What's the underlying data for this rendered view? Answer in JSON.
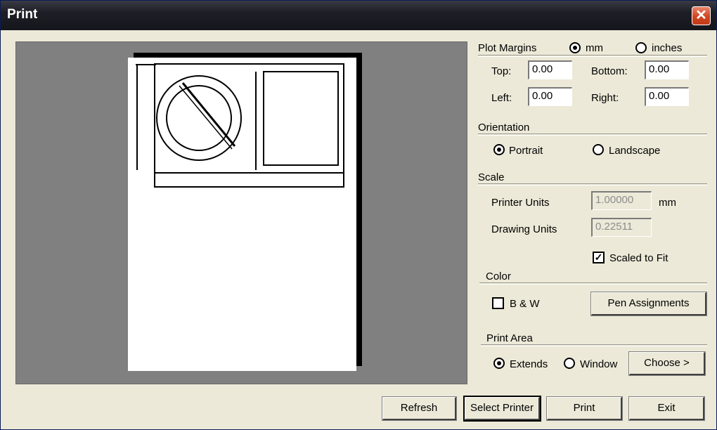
{
  "window": {
    "title": "Print",
    "close_glyph": "✕"
  },
  "plot_margins": {
    "heading": "Plot Margins",
    "unit_mm": "mm",
    "unit_inches": "inches",
    "selected_unit": "mm",
    "top_label": "Top:",
    "top_value": "0.00",
    "bottom_label": "Bottom:",
    "bottom_value": "0.00",
    "left_label": "Left:",
    "left_value": "0.00",
    "right_label": "Right:",
    "right_value": "0.00"
  },
  "orientation": {
    "heading": "Orientation",
    "portrait": "Portrait",
    "landscape": "Landscape",
    "selected": "Portrait"
  },
  "scale": {
    "heading": "Scale",
    "printer_units_label": "Printer Units",
    "printer_units_value": "1.00000",
    "printer_units_unit": "mm",
    "drawing_units_label": "Drawing Units",
    "drawing_units_value": "0.22511",
    "scaled_to_fit_label": "Scaled to Fit",
    "scaled_to_fit_checked": true
  },
  "color": {
    "heading": "Color",
    "bw_label": "B & W",
    "bw_checked": false,
    "pen_assignments_label": "Pen Assignments"
  },
  "print_area": {
    "heading": "Print Area",
    "extends": "Extends",
    "window": "Window",
    "selected": "Extends",
    "choose_label": "Choose >"
  },
  "buttons": {
    "refresh": "Refresh",
    "select_printer": "Select Printer",
    "print": "Print",
    "exit": "Exit"
  },
  "icons": {
    "close": "close-icon",
    "check": "checkmark-icon"
  },
  "colors": {
    "preview_bg": "#808080",
    "paper": "#ffffff",
    "dialog_bg": "#ece9d8",
    "close_button": "#d0441f"
  }
}
